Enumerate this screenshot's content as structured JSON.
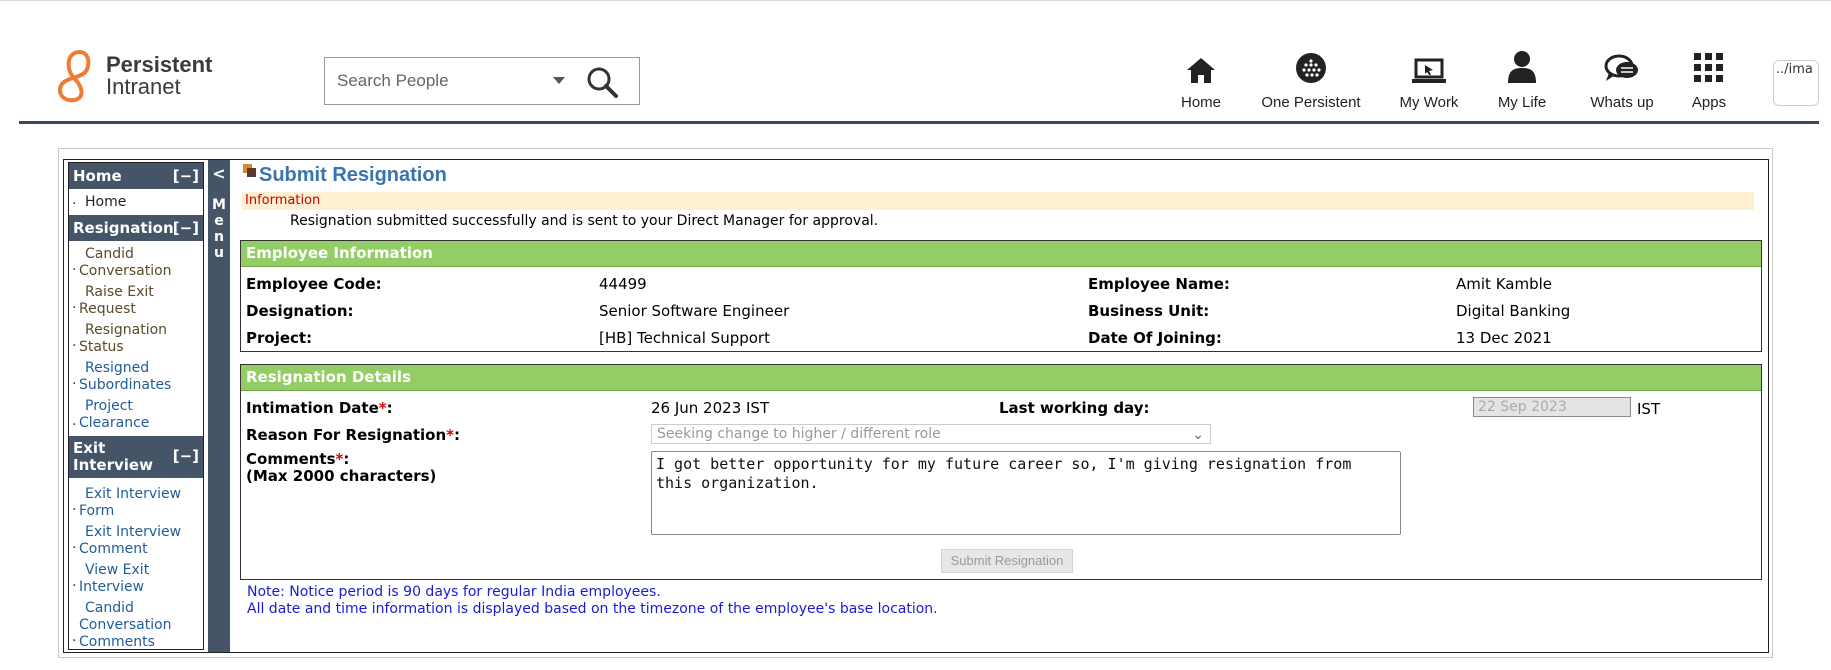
{
  "header": {
    "logo_line1": "Persistent",
    "logo_line2": "Intranet",
    "search_placeholder": "Search People",
    "nav": [
      {
        "label": "Home",
        "icon": "home-icon"
      },
      {
        "label": "One Persistent",
        "icon": "globe-icon"
      },
      {
        "label": "My Work",
        "icon": "laptop-icon"
      },
      {
        "label": "My Life",
        "icon": "person-icon"
      },
      {
        "label": "Whats up",
        "icon": "chat-icon"
      },
      {
        "label": "Apps",
        "icon": "apps-grid-icon"
      }
    ],
    "avatar_alt": "../ima"
  },
  "leftmenu": {
    "back": "<",
    "strip_label": "Menu",
    "groups": [
      {
        "title": "Home",
        "toggle": "[−]",
        "items": [
          "Home"
        ]
      },
      {
        "title": "Resignation",
        "toggle": "[−]",
        "items": [
          "Candid Conversation",
          "Raise Exit Request",
          "Resignation Status",
          "Resigned Subordinates",
          "Project Clearance"
        ]
      },
      {
        "title": "Exit Interview",
        "toggle": "[−]",
        "items": [
          "Exit Interview Form",
          "Exit Interview Comment",
          "View Exit Interview",
          "Candid Conversation Comments"
        ]
      }
    ]
  },
  "page": {
    "title": "Submit Resignation",
    "info_label": "Information",
    "info_message": "Resignation submitted successfully and is sent to your Direct Manager for approval."
  },
  "employee": {
    "heading": "Employee Information",
    "code_label": "Employee Code:",
    "code": "44499",
    "name_label": "Employee Name:",
    "name": "Amit Kamble",
    "designation_label": "Designation:",
    "designation": "Senior Software Engineer",
    "bu_label": "Business Unit:",
    "bu": "Digital Banking",
    "project_label": "Project:",
    "project": "[HB] Technical Support",
    "doj_label": "Date Of Joining:",
    "doj": "13 Dec 2021"
  },
  "resignation": {
    "heading": "Resignation Details",
    "intimation_label": "Intimation Date",
    "intimation": "26 Jun 2023 IST",
    "lwd_label": "Last working day:",
    "lwd": "22 Sep 2023",
    "lwd_tz": "IST",
    "reason_label": "Reason For Resignation",
    "reason": "Seeking change to higher / different role",
    "comments_label": "Comments",
    "comments_sub": "(Max 2000 characters)",
    "comments": "I got better opportunity for my future career so, I'm giving resignation from this organization.",
    "submit": "Submit Resignation"
  },
  "notes": {
    "line1": "Note: Notice period is 90 days for regular India employees.",
    "line2": "All date and time information is displayed based on the timezone of the employee's base location."
  }
}
